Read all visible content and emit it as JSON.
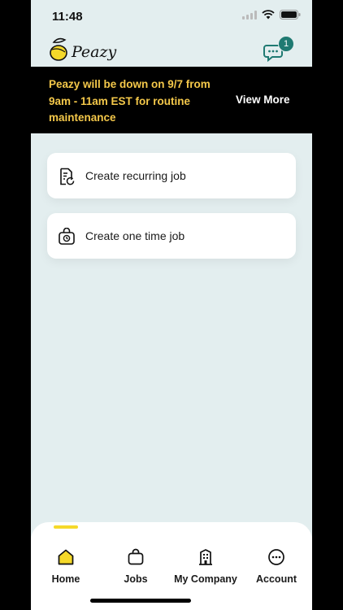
{
  "status_bar": {
    "time": "11:48"
  },
  "header": {
    "logo_text": "Peazy",
    "chat_badge_count": "1"
  },
  "banner": {
    "message": "Peazy will be down on 9/7 from 9am - 11am EST for routine maintenance",
    "link_label": "View More"
  },
  "actions": [
    {
      "label": "Create recurring job",
      "icon": "recurring-job-icon"
    },
    {
      "label": "Create one time job",
      "icon": "one-time-job-icon"
    }
  ],
  "tabs": [
    {
      "label": "Home",
      "icon": "home-icon",
      "active": true
    },
    {
      "label": "Jobs",
      "icon": "bag-icon",
      "active": false
    },
    {
      "label": "My Company",
      "icon": "building-icon",
      "active": false
    },
    {
      "label": "Account",
      "icon": "more-icon",
      "active": false
    }
  ],
  "colors": {
    "background": "#e3eeef",
    "banner_bg": "#000000",
    "banner_text": "#f4c84a",
    "accent_yellow": "#f5d92a",
    "badge_teal": "#1f7a72"
  }
}
